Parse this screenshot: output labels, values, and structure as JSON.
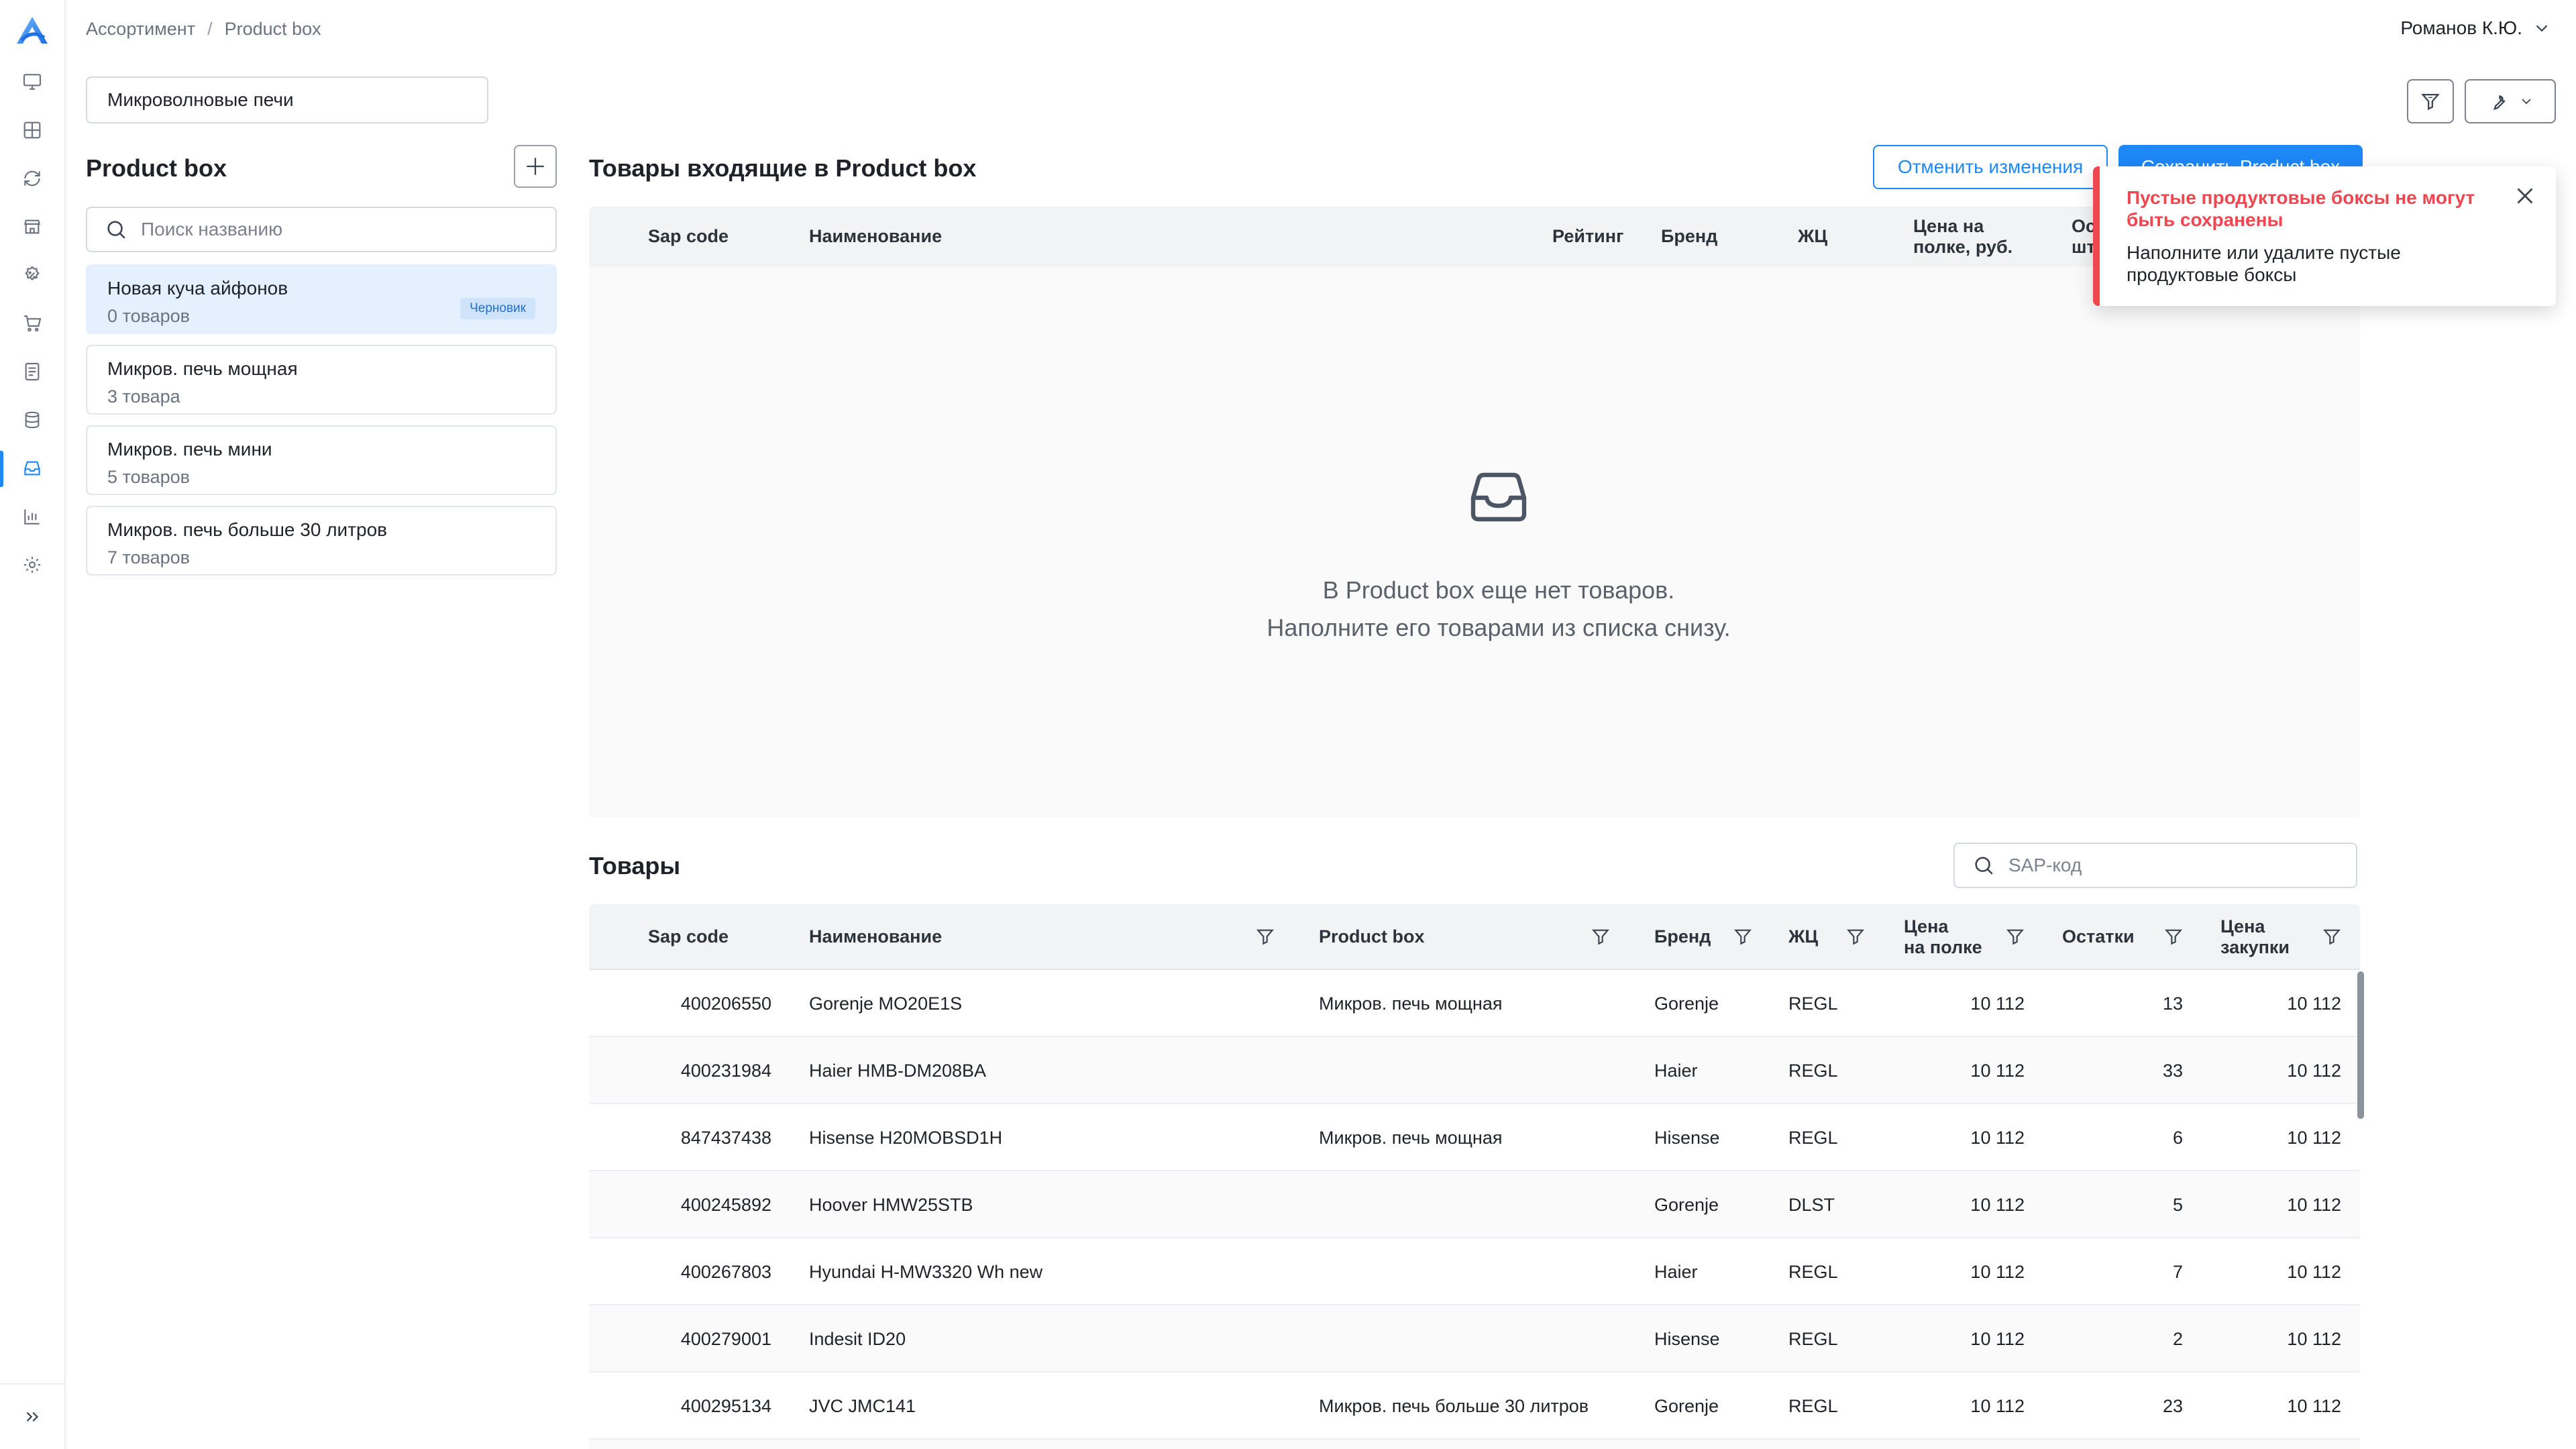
{
  "breadcrumb": {
    "parent": "Ассортимент",
    "separator": "/",
    "current": "Product box"
  },
  "user": {
    "name": "Романов К.Ю."
  },
  "category": {
    "value": "Микроволновые печи"
  },
  "left_panel": {
    "title": "Product box",
    "search_placeholder": "Поиск названию",
    "items": [
      {
        "name": "Новая куча айфонов",
        "count": "0 товаров",
        "badge": "Черновик"
      },
      {
        "name": "Микров. печь мощная",
        "count": "3 товара"
      },
      {
        "name": "Микров. печь мини",
        "count": "5 товаров"
      },
      {
        "name": "Микров. печь больше 30 литров",
        "count": "7 товаров"
      }
    ]
  },
  "main": {
    "title": "Товары входящие в Product box",
    "cancel_label": "Отменить изменения",
    "save_label": "Сохранить Product box",
    "top_columns": {
      "sap": "Sap code",
      "name": "Наименование",
      "rating": "Рейтинг",
      "brand": "Бренд",
      "lc": "ЖЦ",
      "price_l1": "Цена на",
      "price_l2": "полке, руб.",
      "stock_l1": "Ост",
      "stock_l2": "шт"
    },
    "empty_line1": "В Product box еще нет товаров.",
    "empty_line2": "Наполните его товарами из списка снизу."
  },
  "toast": {
    "title": "Пустые продуктовые боксы не могут быть сохранены",
    "message": "Наполните или удалите пустые продуктовые боксы"
  },
  "products": {
    "title": "Товары",
    "search_placeholder": "SAP-код",
    "columns": {
      "sap": "Sap code",
      "name": "Наименование",
      "pbox": "Product box",
      "brand": "Бренд",
      "lc": "ЖЦ",
      "price_l1": "Цена",
      "price_l2": "на полке",
      "stock": "Остатки",
      "purchase_l1": "Цена",
      "purchase_l2": "закупки"
    },
    "rows": [
      {
        "sap": "400206550",
        "name": "Gorenje MO20E1S",
        "pbox": "Микров. печь мощная",
        "brand": "Gorenje",
        "lc": "REGL",
        "price": "10 112",
        "stock": "13",
        "purchase": "10 112"
      },
      {
        "sap": "400231984",
        "name": "Haier HMB-DM208BA",
        "pbox": "",
        "brand": "Haier",
        "lc": "REGL",
        "price": "10 112",
        "stock": "33",
        "purchase": "10 112"
      },
      {
        "sap": "847437438",
        "name": "Hisense H20MOBSD1H",
        "pbox": "Микров. печь мощная",
        "brand": "Hisense",
        "lc": "REGL",
        "price": "10 112",
        "stock": "6",
        "purchase": "10 112"
      },
      {
        "sap": "400245892",
        "name": "Hoover HMW25STB",
        "pbox": "",
        "brand": "Gorenje",
        "lc": "DLST",
        "price": "10 112",
        "stock": "5",
        "purchase": "10 112"
      },
      {
        "sap": "400267803",
        "name": "Hyundai H-MW3320 Wh new",
        "pbox": "",
        "brand": "Haier",
        "lc": "REGL",
        "price": "10 112",
        "stock": "7",
        "purchase": "10 112"
      },
      {
        "sap": "400279001",
        "name": "Indesit ID20",
        "pbox": "",
        "brand": "Hisense",
        "lc": "REGL",
        "price": "10 112",
        "stock": "2",
        "purchase": "10 112"
      },
      {
        "sap": "400295134",
        "name": "JVC JMC141",
        "pbox": "Микров. печь больше 30 литров",
        "brand": "Gorenje",
        "lc": "REGL",
        "price": "10 112",
        "stock": "23",
        "purchase": "10 112"
      },
      {
        "sap": "",
        "name": "",
        "pbox": "",
        "brand": "",
        "lc": "",
        "price": "",
        "stock": "",
        "purchase": ""
      }
    ]
  },
  "colors": {
    "accent": "#1e88f7",
    "error": "#f0464f",
    "selected_bg": "#e4f0fd"
  }
}
